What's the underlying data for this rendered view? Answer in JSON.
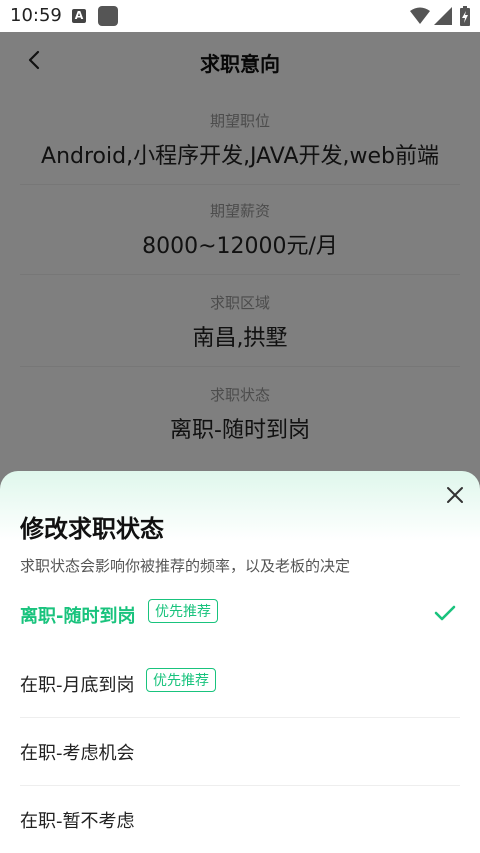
{
  "status_bar": {
    "time": "10:59",
    "a_icon_letter": "A"
  },
  "header": {
    "title": "求职意向"
  },
  "fields": [
    {
      "label": "期望职位",
      "value": "Android,小程序开发,JAVA开发,web前端"
    },
    {
      "label": "期望薪资",
      "value": "8000~12000元/月"
    },
    {
      "label": "求职区域",
      "value": "南昌,拱墅"
    },
    {
      "label": "求职状态",
      "value": "离职-随时到岗"
    }
  ],
  "sheet": {
    "title": "修改求职状态",
    "subtitle": "求职状态会影响你被推荐的频率，以及老板的决定",
    "options": [
      {
        "label": "离职-随时到岗",
        "badge": "优先推荐",
        "selected": true
      },
      {
        "label": "在职-月底到岗",
        "badge": "优先推荐",
        "selected": false
      },
      {
        "label": "在职-考虑机会",
        "badge": "",
        "selected": false
      },
      {
        "label": "在职-暂不考虑",
        "badge": "",
        "selected": false
      }
    ]
  },
  "colors": {
    "accent": "#19c37d",
    "overlay": "rgba(0,0,0,0.5)"
  }
}
